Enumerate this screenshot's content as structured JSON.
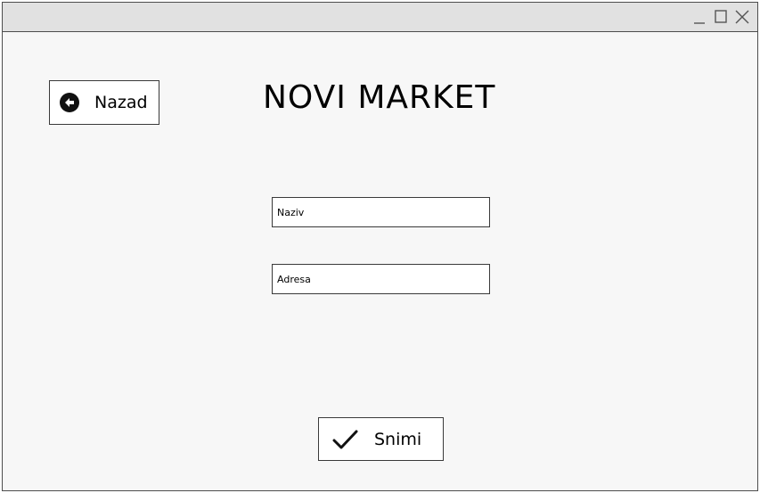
{
  "window": {
    "controls": {
      "minimize_icon": "minimize-icon",
      "maximize_icon": "maximize-icon",
      "close_icon": "close-icon"
    }
  },
  "header": {
    "back_label": "Nazad",
    "back_icon": "arrow-left-circle-icon",
    "title": "NOVI MARKET"
  },
  "form": {
    "name_field": {
      "placeholder": "Naziv",
      "value": ""
    },
    "address_field": {
      "placeholder": "Adresa",
      "value": ""
    }
  },
  "footer": {
    "save_label": "Snimi",
    "save_icon": "checkmark-icon"
  },
  "colors": {
    "titlebar": "#e1e1e1",
    "canvas": "#f7f7f7",
    "border": "#3a3a3a"
  }
}
